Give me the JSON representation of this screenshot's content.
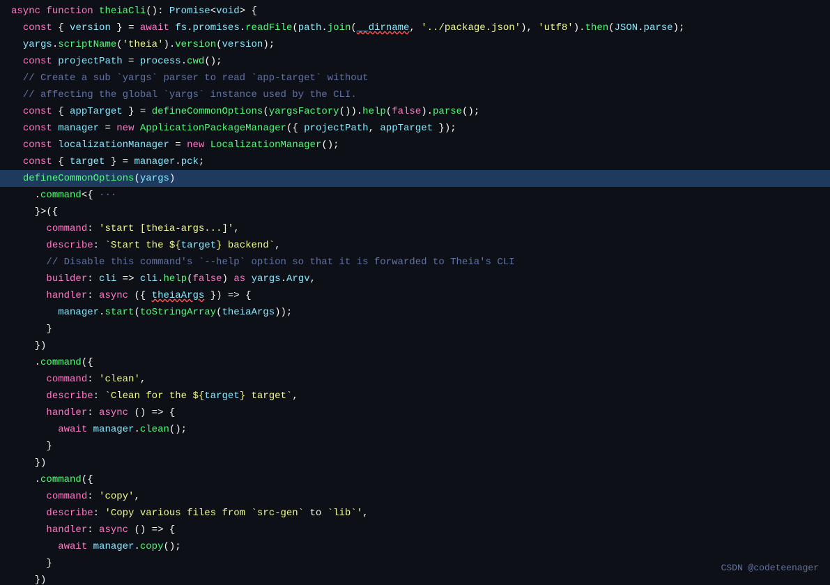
{
  "watermark": "CSDN @codeteenager",
  "lines": [
    {
      "id": 1,
      "highlighted": false
    },
    {
      "id": 2,
      "highlighted": false
    },
    {
      "id": 3,
      "highlighted": false
    },
    {
      "id": 4,
      "highlighted": false
    },
    {
      "id": 5,
      "highlighted": false
    },
    {
      "id": 6,
      "highlighted": false
    },
    {
      "id": 7,
      "highlighted": false
    },
    {
      "id": 8,
      "highlighted": false
    },
    {
      "id": 9,
      "highlighted": false
    },
    {
      "id": 10,
      "highlighted": false
    },
    {
      "id": 11,
      "highlighted": true
    },
    {
      "id": 12,
      "highlighted": false
    },
    {
      "id": 13,
      "highlighted": false
    }
  ]
}
